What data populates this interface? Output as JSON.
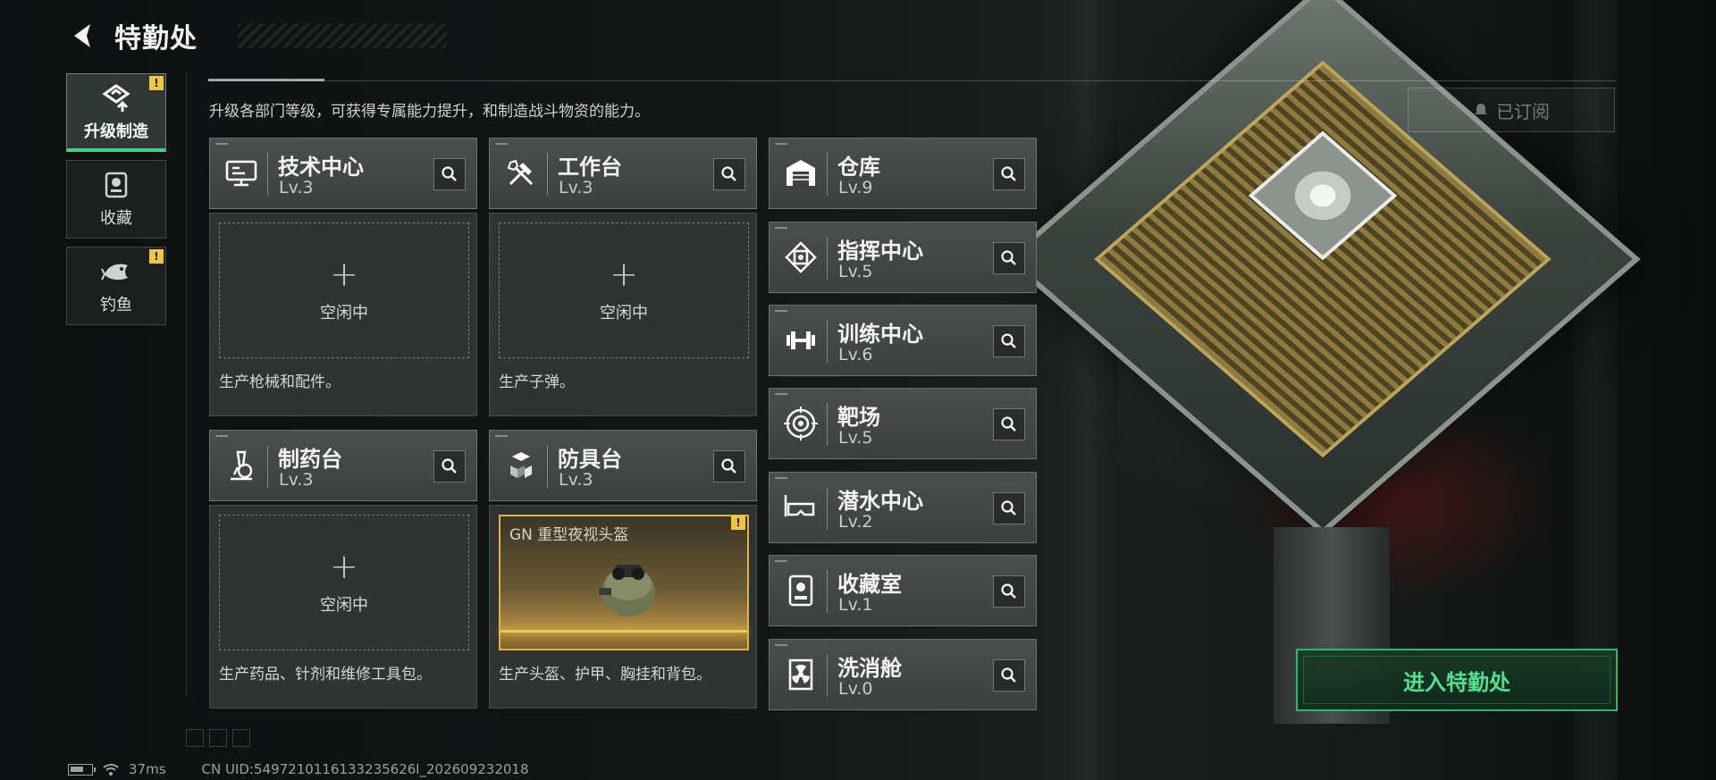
{
  "header": {
    "title": "特勤处"
  },
  "sidebar": {
    "items": [
      {
        "label": "升级制造",
        "icon": "upgrade-build-icon",
        "active": true,
        "alert": "!"
      },
      {
        "label": "收藏",
        "icon": "collection-icon",
        "active": false,
        "alert": ""
      },
      {
        "label": "钓鱼",
        "icon": "fish-icon",
        "active": false,
        "alert": "!"
      }
    ]
  },
  "description": "升级各部门等级，可获得专属能力提升，和制造战斗物资的能力。",
  "subscribed_label": "已订阅",
  "departments": {
    "tech_center": {
      "name": "技术中心",
      "level": "Lv.3",
      "icon": "monitor-icon",
      "status": "空闲中",
      "desc": "生产枪械和配件。"
    },
    "workbench": {
      "name": "工作台",
      "level": "Lv.3",
      "icon": "tools-icon",
      "status": "空闲中",
      "desc": "生产子弹。"
    },
    "pharmacy": {
      "name": "制药台",
      "level": "Lv.3",
      "icon": "microscope-icon",
      "status": "空闲中",
      "desc": "生产药品、针剂和维修工具包。"
    },
    "armor_bench": {
      "name": "防具台",
      "level": "Lv.3",
      "icon": "cubes-icon",
      "desc": "生产头盔、护甲、胸挂和背包。",
      "item": {
        "name": "GN 重型夜视头盔",
        "alert": "!"
      }
    },
    "warehouse": {
      "name": "仓库",
      "level": "Lv.9",
      "icon": "warehouse-icon"
    },
    "command": {
      "name": "指挥中心",
      "level": "Lv.5",
      "icon": "chip-icon"
    },
    "training": {
      "name": "训练中心",
      "level": "Lv.6",
      "icon": "dumbbell-icon"
    },
    "range": {
      "name": "靶场",
      "level": "Lv.5",
      "icon": "target-icon"
    },
    "diving": {
      "name": "潜水中心",
      "level": "Lv.2",
      "icon": "diving-mask-icon"
    },
    "collection_room": {
      "name": "收藏室",
      "level": "Lv.1",
      "icon": "collection-room-icon"
    },
    "decon": {
      "name": "洗消舱",
      "level": "Lv.0",
      "icon": "radiation-icon"
    }
  },
  "enter_button": "进入特勤处",
  "status": {
    "ping": "37ms",
    "uid": "CN UID:5497210116133235626l_202609232018"
  },
  "colors": {
    "accent_green": "#3fd08a",
    "alert_yellow": "#f0c641",
    "item_gold": "#e0b34a"
  }
}
